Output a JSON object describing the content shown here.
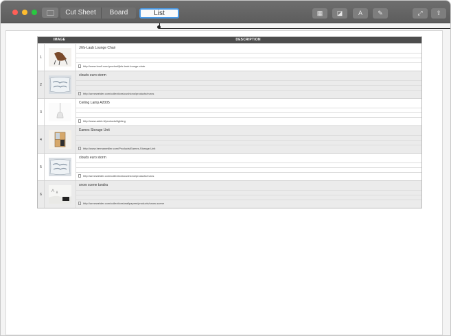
{
  "toolbar": {
    "tabs": [
      {
        "label": "Cut Sheet"
      },
      {
        "label": "Board"
      },
      {
        "label": "List"
      }
    ]
  },
  "table": {
    "headers": {
      "image": "IMAGE",
      "description": "DESCRIPTION"
    },
    "rows": [
      {
        "num": "1",
        "title": "Jhfs-Laub Lounge Chair",
        "url": "http://www.knoll.com/product/jhfs-laub-lounge-chair",
        "thumb": "chair"
      },
      {
        "num": "2",
        "title": "clouds euro storm",
        "url": "http://annewelder.com/collections/cushions/products/euros",
        "thumb": "pillow"
      },
      {
        "num": "3",
        "title": "Ceiling Lamp A2005",
        "url": "http://www.artek.fi/products/lighting",
        "thumb": "lamp"
      },
      {
        "num": "4",
        "title": "Eames Storage Unit",
        "url": "http://www.hermanmiller.com/Products/Eames-Storage-Unit",
        "thumb": "storage"
      },
      {
        "num": "5",
        "title": "clouds euro storm",
        "url": "http://annewelder.com/collections/cushions/products/euros",
        "thumb": "pillow"
      },
      {
        "num": "6",
        "title": "snow scene tundra",
        "url": "http://annewelder.com/collections/wallpapers/products/snow-scene",
        "thumb": "snow"
      }
    ]
  }
}
